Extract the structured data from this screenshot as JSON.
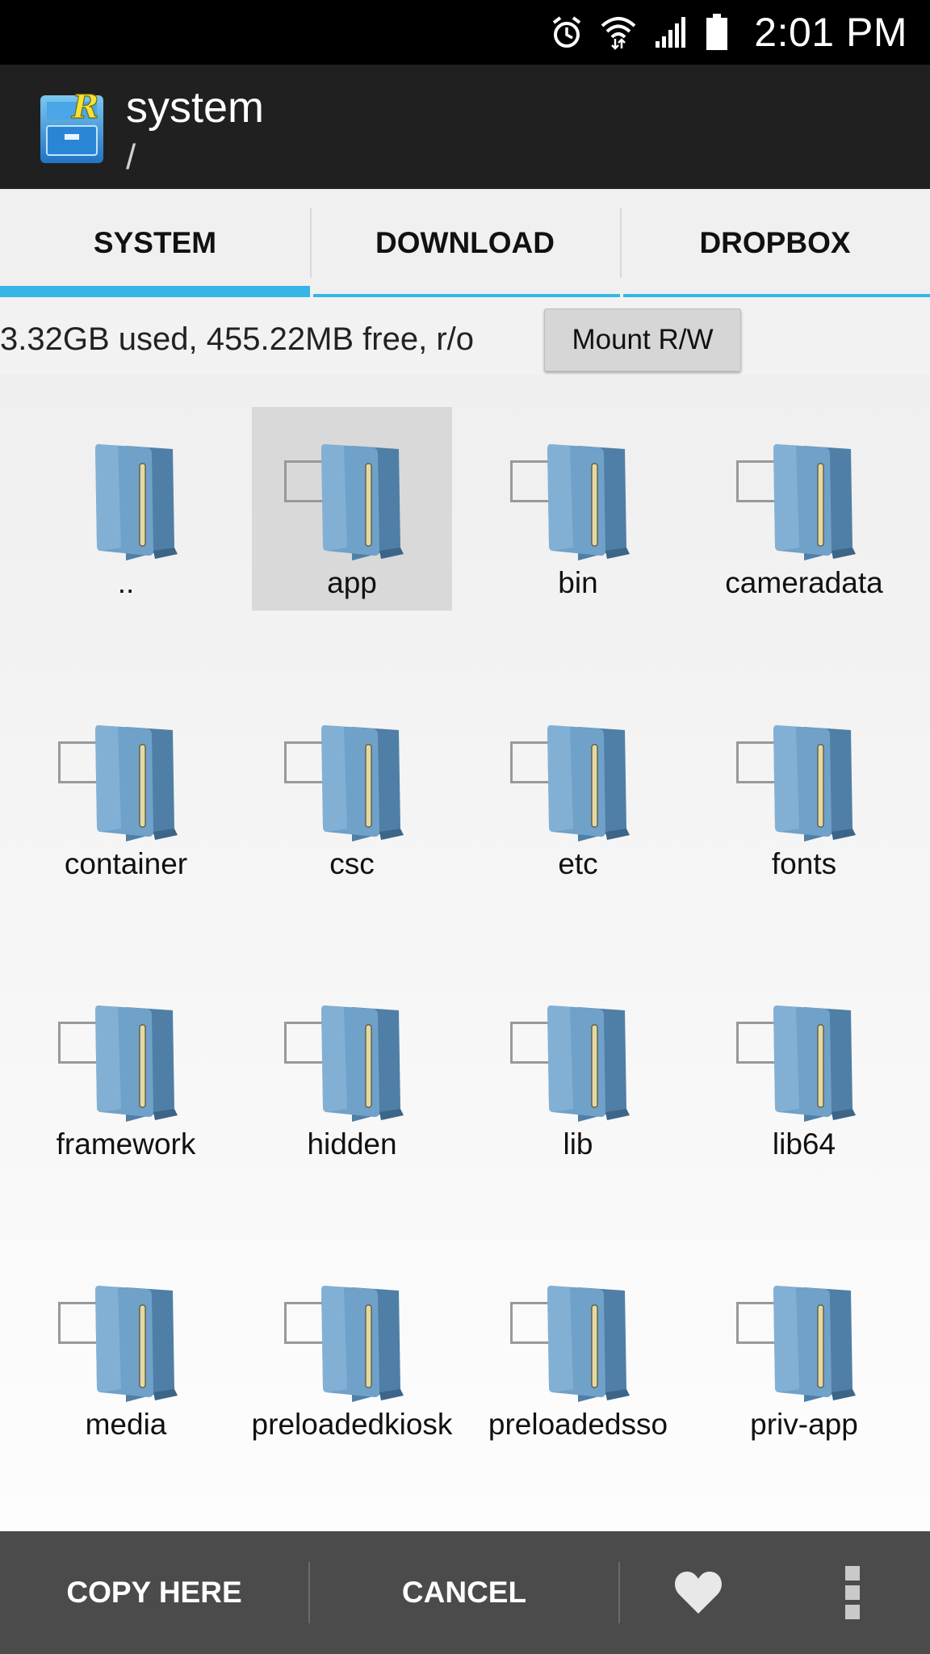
{
  "status_bar": {
    "time": "2:01 PM",
    "icons": [
      "alarm-icon",
      "wifi-icon",
      "signal-icon",
      "battery-icon"
    ]
  },
  "action_bar": {
    "title": "system",
    "subtitle": "/",
    "logo_letter": "R"
  },
  "tabs": [
    {
      "label": "SYSTEM",
      "active": true
    },
    {
      "label": "DOWNLOAD",
      "active": false
    },
    {
      "label": "DROPBOX",
      "active": false
    }
  ],
  "storage": {
    "info": "3.32GB used, 455.22MB free, r/o",
    "mount_button": "Mount R/W"
  },
  "folders": [
    {
      "name": "..",
      "checkbox": false,
      "selected": false
    },
    {
      "name": "app",
      "checkbox": true,
      "selected": true
    },
    {
      "name": "bin",
      "checkbox": true,
      "selected": false
    },
    {
      "name": "cameradata",
      "checkbox": true,
      "selected": false
    },
    {
      "name": "container",
      "checkbox": true,
      "selected": false
    },
    {
      "name": "csc",
      "checkbox": true,
      "selected": false
    },
    {
      "name": "etc",
      "checkbox": true,
      "selected": false
    },
    {
      "name": "fonts",
      "checkbox": true,
      "selected": false
    },
    {
      "name": "framework",
      "checkbox": true,
      "selected": false
    },
    {
      "name": "hidden",
      "checkbox": true,
      "selected": false
    },
    {
      "name": "lib",
      "checkbox": true,
      "selected": false
    },
    {
      "name": "lib64",
      "checkbox": true,
      "selected": false
    },
    {
      "name": "media",
      "checkbox": true,
      "selected": false
    },
    {
      "name": "preloadedkiosk",
      "checkbox": true,
      "selected": false
    },
    {
      "name": "preloadedsso",
      "checkbox": true,
      "selected": false
    },
    {
      "name": "priv-app",
      "checkbox": true,
      "selected": false
    }
  ],
  "bottom_bar": {
    "copy_here": "COPY HERE",
    "cancel": "CANCEL",
    "icons": [
      "heart-icon",
      "overflow-menu-icon"
    ]
  },
  "colors": {
    "tab_accent": "#35b6e6",
    "action_bar": "#202020",
    "bottom_bar": "#4b4b4b",
    "folder": "#6c9fc4"
  }
}
